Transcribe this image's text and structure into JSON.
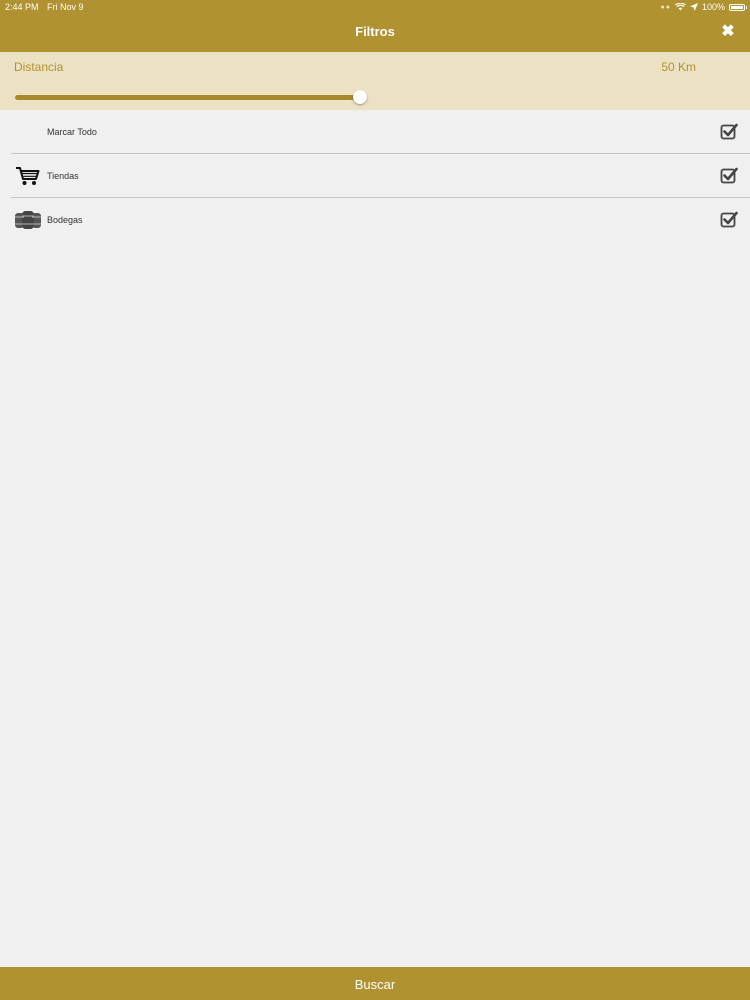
{
  "status_bar": {
    "time": "2:44 PM",
    "date": "Fri Nov 9",
    "battery": "100%"
  },
  "header": {
    "title": "Filtros",
    "close_glyph": "✖"
  },
  "distance": {
    "label": "Distancia",
    "value_text": "50 Km",
    "slider_fraction": 0.5
  },
  "filters": [
    {
      "label": "Marcar Todo",
      "icon": "",
      "checked": true
    },
    {
      "label": "Tiendas",
      "icon": "shopping-cart-icon",
      "checked": true
    },
    {
      "label": "Bodegas",
      "icon": "barrels-icon",
      "checked": true
    }
  ],
  "footer": {
    "button_label": "Buscar"
  },
  "colors": {
    "brand": "#b09230",
    "panel": "#ece2c3",
    "background": "#f0f0f0"
  }
}
